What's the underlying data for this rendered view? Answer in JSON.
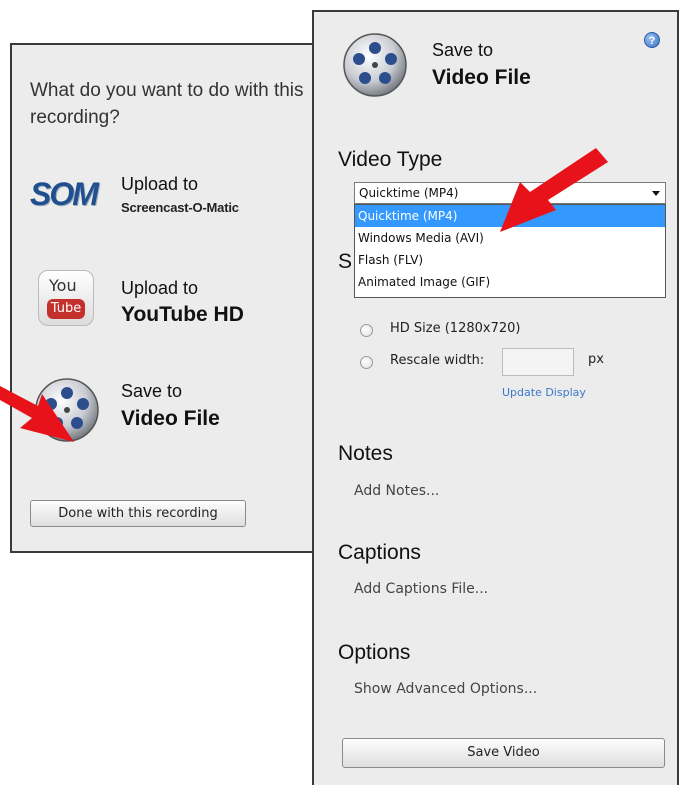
{
  "left_panel": {
    "prompt": "What do you want to do with this recording?",
    "options": [
      {
        "line1": "Upload to",
        "line2": "Screencast-O-Matic",
        "logo_text": "SOM"
      },
      {
        "line1": "Upload to",
        "line2": "YouTube HD",
        "logo_you": "You",
        "logo_tube": "Tube"
      },
      {
        "line1": "Save to",
        "line2": "Video File"
      }
    ],
    "done_button": "Done with this recording"
  },
  "right_panel": {
    "title_line1": "Save to",
    "title_line2": "Video File",
    "help_icon_glyph": "?",
    "video_type": {
      "heading": "Video Type",
      "selected": "Quicktime (MP4)",
      "options": [
        "Quicktime (MP4)",
        "Windows Media (AVI)",
        "Flash (FLV)",
        "Animated Image (GIF)"
      ]
    },
    "size": {
      "heading_visible": "S",
      "hd_label": "HD Size (1280x720)",
      "rescale_label": "Rescale width:",
      "rescale_value": "",
      "unit": "px",
      "update_link": "Update Display"
    },
    "notes": {
      "heading": "Notes",
      "link": "Add Notes..."
    },
    "captions": {
      "heading": "Captions",
      "link": "Add Captions File..."
    },
    "options": {
      "heading": "Options",
      "link": "Show Advanced Options..."
    },
    "save_button": "Save Video"
  },
  "colors": {
    "panel_bg": "#ececec",
    "selection_blue": "#3399ff",
    "link_blue": "#3a78c8",
    "arrow_red": "#e8131a"
  }
}
